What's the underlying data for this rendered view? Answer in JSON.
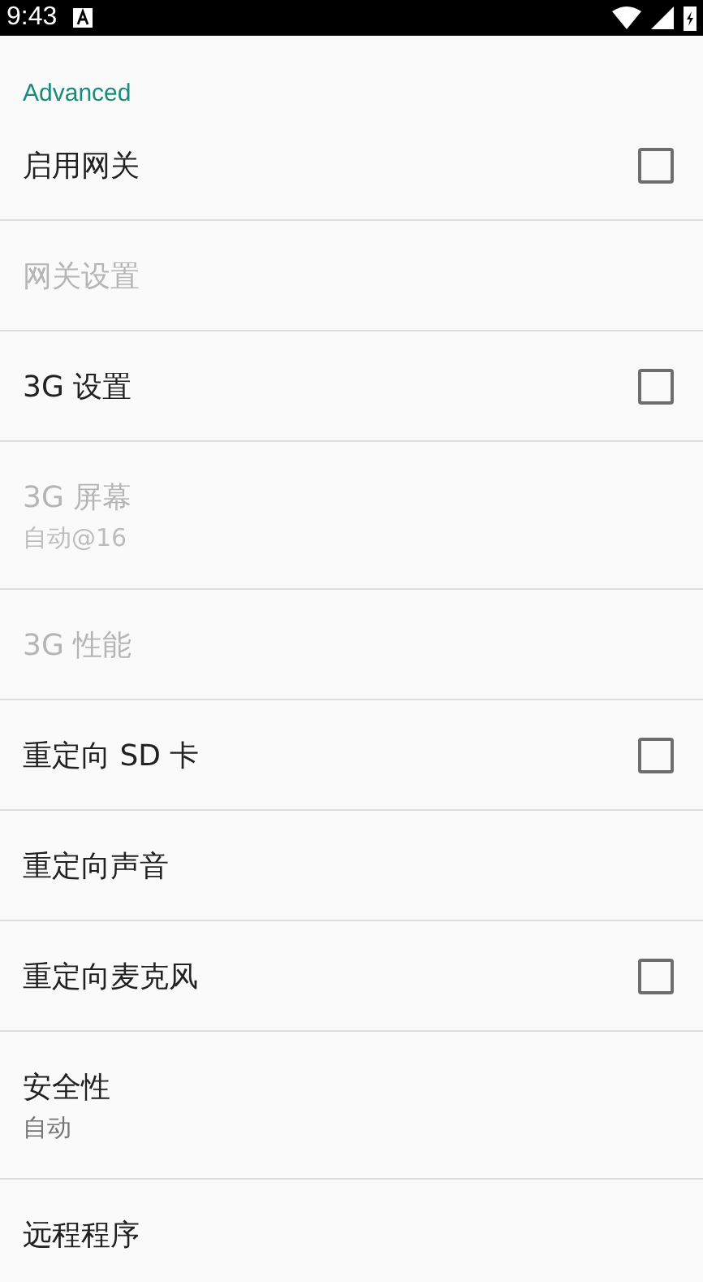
{
  "status_bar": {
    "time": "9:43"
  },
  "section": {
    "title": "Advanced"
  },
  "items": [
    {
      "kind": "checkbox",
      "title": "启用网关",
      "disabled": false,
      "checked": false
    },
    {
      "kind": "plain",
      "title": "网关设置",
      "disabled": true
    },
    {
      "kind": "checkbox",
      "title": "3G 设置",
      "disabled": false,
      "checked": false
    },
    {
      "kind": "plain",
      "title": "3G 屏幕",
      "summary": "自动@16",
      "disabled": true
    },
    {
      "kind": "plain",
      "title": "3G 性能",
      "disabled": true
    },
    {
      "kind": "checkbox",
      "title": "重定向 SD 卡",
      "disabled": false,
      "checked": false
    },
    {
      "kind": "plain",
      "title": "重定向声音",
      "disabled": false
    },
    {
      "kind": "checkbox",
      "title": "重定向麦克风",
      "disabled": false,
      "checked": false
    },
    {
      "kind": "plain",
      "title": "安全性",
      "summary": "自动",
      "disabled": false
    },
    {
      "kind": "plain",
      "title": "远程程序",
      "disabled": false
    }
  ]
}
